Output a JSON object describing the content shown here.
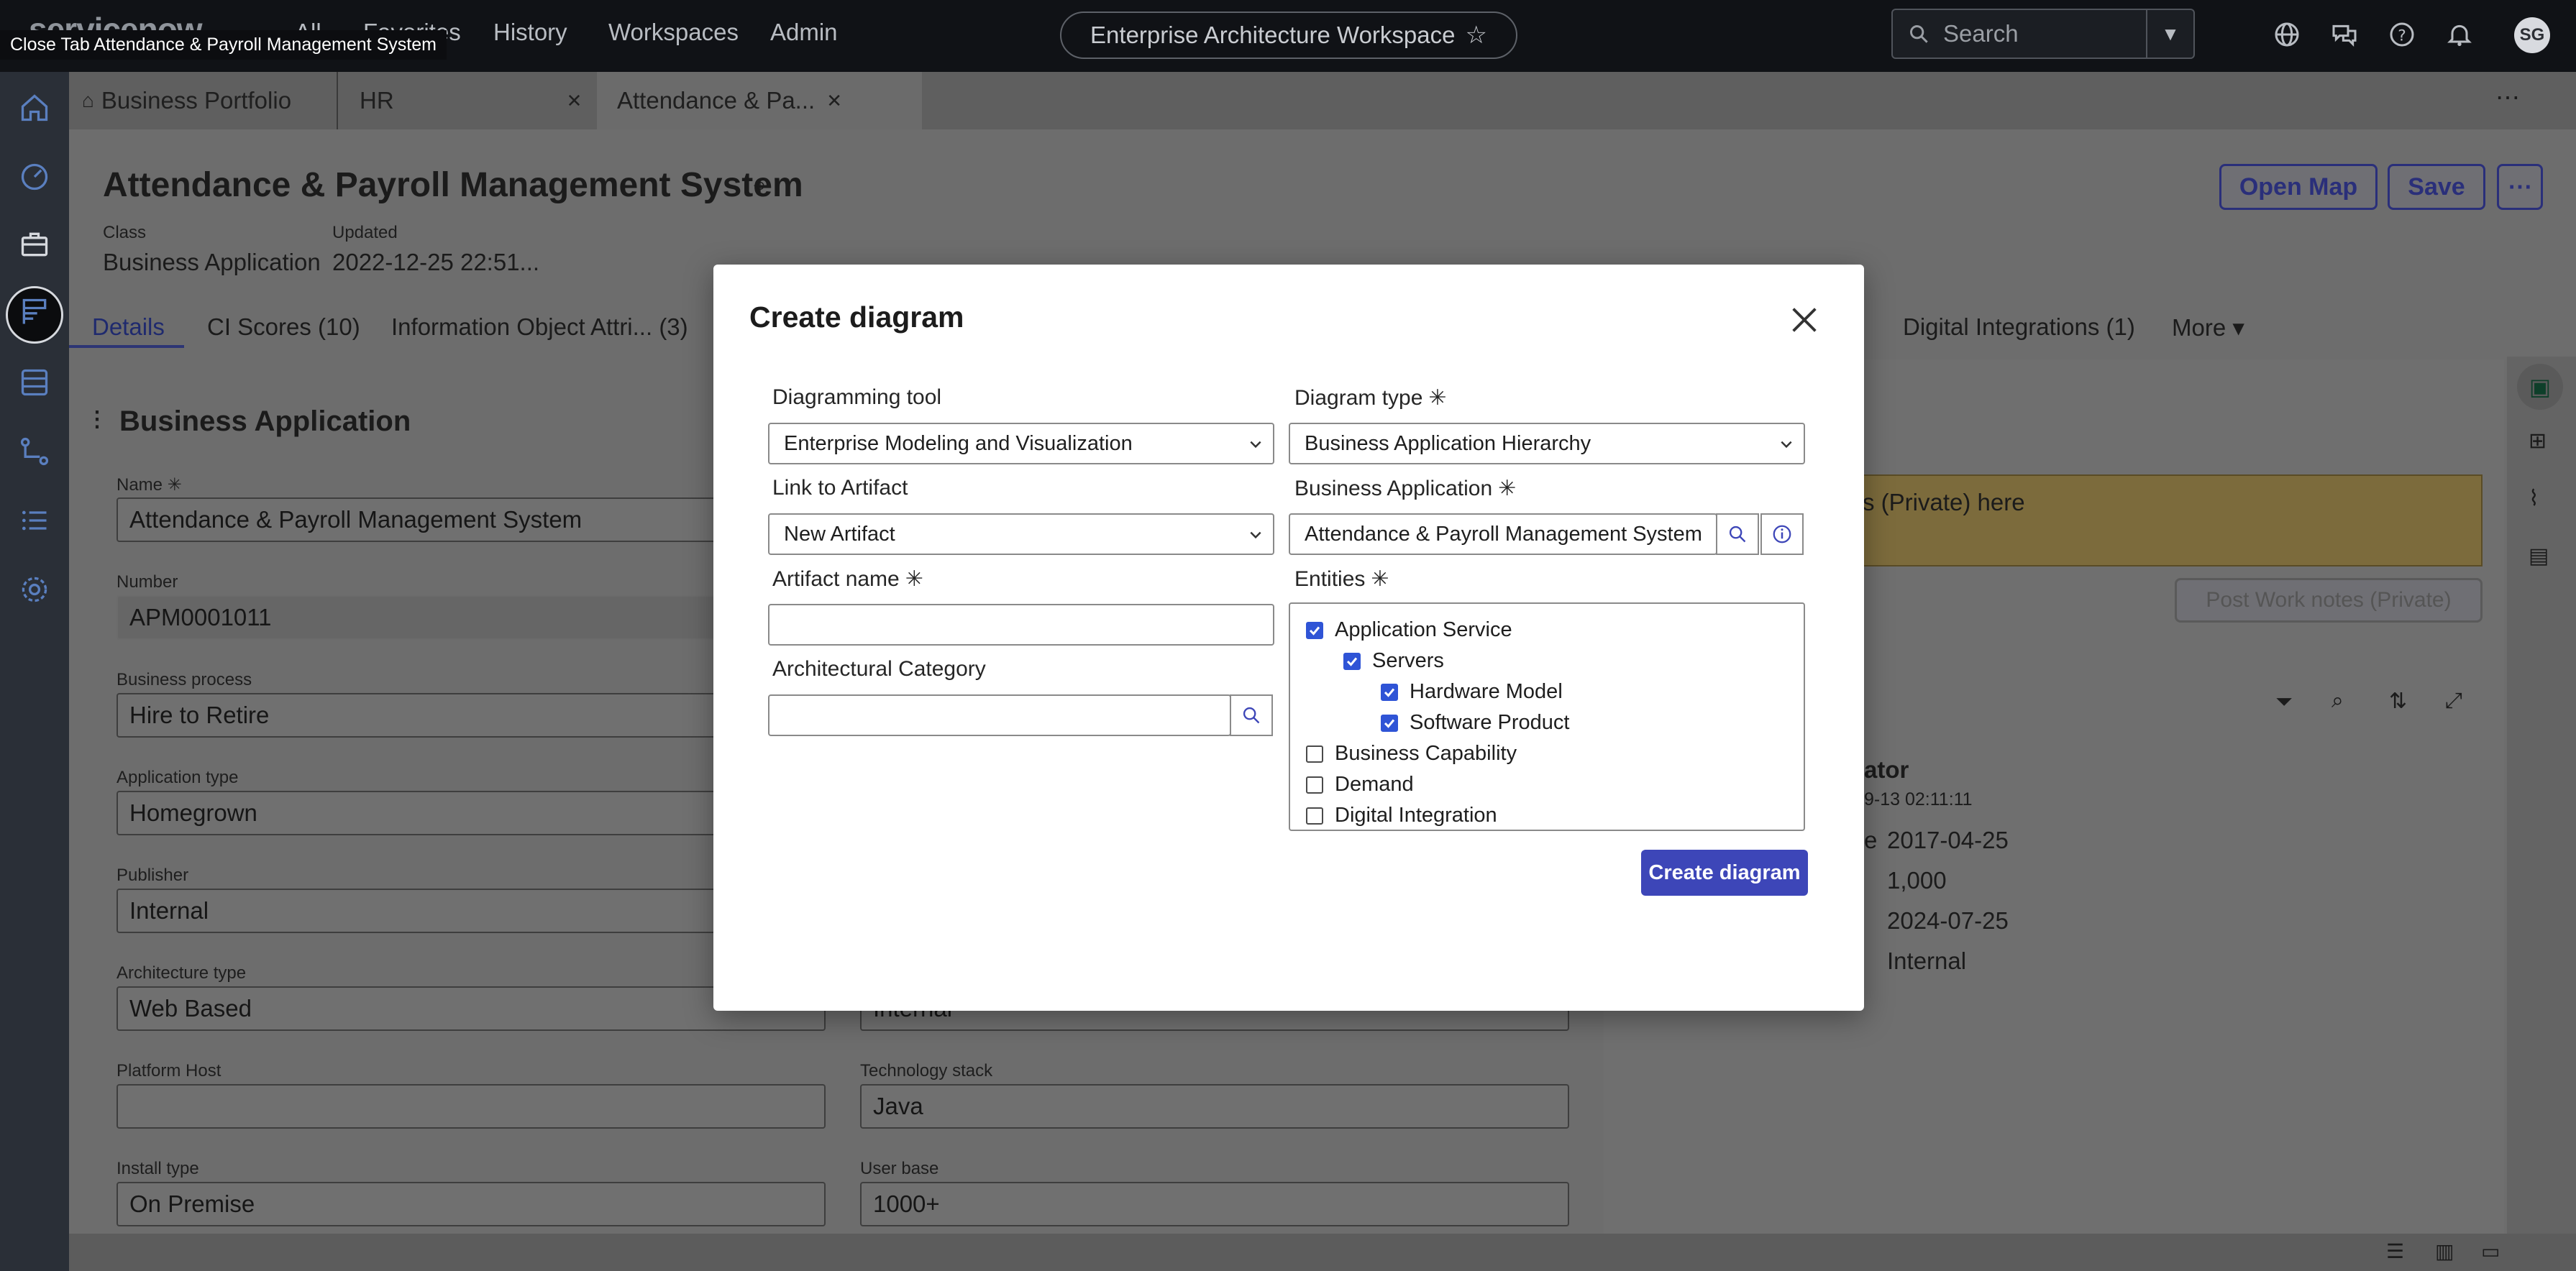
{
  "tooltip": "Close Tab Attendance & Payroll Management System",
  "topnav": {
    "logo": "servicenow",
    "links": [
      "All",
      "Favorites",
      "History",
      "Workspaces",
      "Admin"
    ],
    "workspace": "Enterprise Architecture Workspace",
    "search_placeholder": "Search",
    "avatar_initials": "SG"
  },
  "tabs": [
    {
      "label": "Business Portfolio"
    },
    {
      "label": "HR"
    },
    {
      "label": "Attendance & Pa..."
    }
  ],
  "record": {
    "title": "Attendance & Payroll Management System",
    "class_label": "Class",
    "class_value": "Business Application",
    "updated_label": "Updated",
    "updated_value": "2022-12-25 22:51...",
    "open_map": "Open Map",
    "save": "Save"
  },
  "subtabs": [
    {
      "label": "Details"
    },
    {
      "label": "CI Scores (10)"
    },
    {
      "label": "Information Object Attri...  (3)"
    },
    {
      "label": "Digital Integrations (1)"
    },
    {
      "label": "More"
    }
  ],
  "form": {
    "section": "Business Application",
    "name_label": "Name",
    "name_value": "Attendance & Payroll Management System",
    "number_label": "Number",
    "number_value": "APM0001011",
    "bp_label": "Business process",
    "bp_value": "Hire to Retire",
    "apptype_label": "Application type",
    "apptype_value": "Homegrown",
    "publisher_label": "Publisher",
    "publisher_value": "Internal",
    "arch_label": "Architecture type",
    "arch_value": "Web Based",
    "arch_right_value": "Internal",
    "platform_label": "Platform Host",
    "tech_label": "Technology stack",
    "tech_value": "Java",
    "install_label": "Install type",
    "install_value": "On Premise",
    "userbase_label": "User base",
    "userbase_value": "1000+"
  },
  "right": {
    "worknote_text": "s (Private) here",
    "post_button": "Post Work notes (Private)",
    "activity_label": "ator",
    "activity_time": "9-13 02:11:11",
    "row_label": "e",
    "values": [
      "2017-04-25",
      "1,000",
      "2024-07-25",
      "Internal"
    ]
  },
  "modal": {
    "title": "Create diagram",
    "tool_label": "Diagramming tool",
    "tool_value": "Enterprise Modeling and Visualization",
    "type_label": "Diagram type",
    "type_value": "Business Application Hierarchy",
    "link_label": "Link to Artifact",
    "link_value": "New Artifact",
    "ba_label": "Business Application",
    "ba_value": "Attendance & Payroll Management System",
    "artifact_label": "Artifact name",
    "artifact_value": "",
    "arch_cat_label": "Architectural Category",
    "arch_cat_value": "",
    "entities_label": "Entities",
    "entities": [
      {
        "label": "Application Service",
        "checked": true
      },
      {
        "label": "Servers",
        "checked": true
      },
      {
        "label": "Hardware Model",
        "checked": true
      },
      {
        "label": "Software Product",
        "checked": true
      },
      {
        "label": "Business Capability",
        "checked": false
      },
      {
        "label": "Demand",
        "checked": false
      },
      {
        "label": "Digital Integration",
        "checked": false
      }
    ],
    "create_button": "Create diagram",
    "required_mark": "✳"
  }
}
